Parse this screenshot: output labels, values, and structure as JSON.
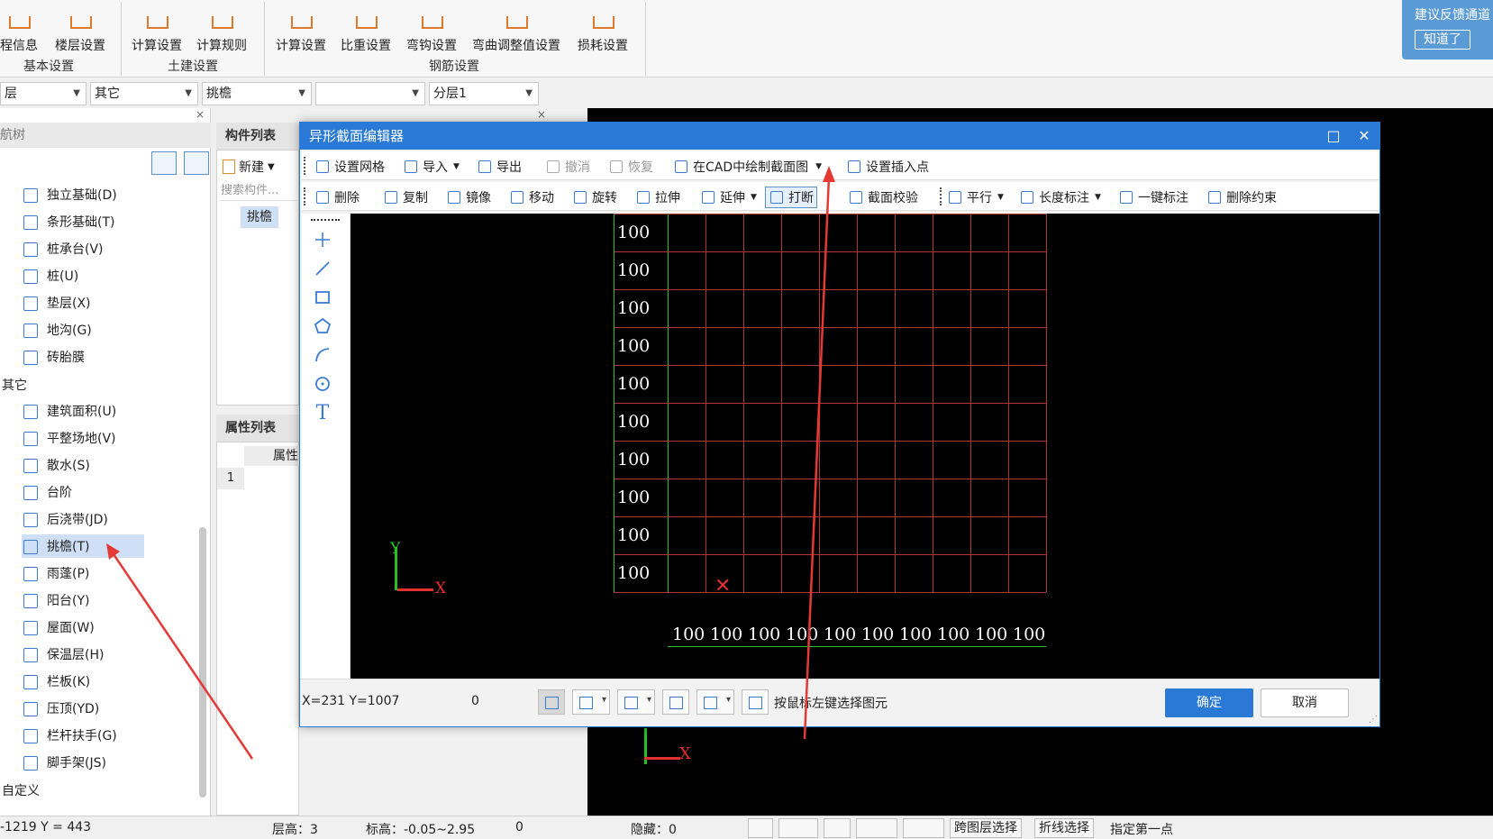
{
  "ribbon": {
    "buttons": [
      "程信息",
      "楼层设置",
      "计算设置",
      "计算规则",
      "计算设置",
      "比重设置",
      "弯钩设置",
      "弯曲调整值设置",
      "损耗设置"
    ],
    "groups": [
      "基本设置",
      "土建设置",
      "钢筋设置"
    ]
  },
  "feedback": {
    "text": "建议反馈通道",
    "button": "知道了"
  },
  "dropdowns": [
    "层",
    "其它",
    "挑檐",
    "",
    "分层1"
  ],
  "left_panel": {
    "header": "航树",
    "items": [
      {
        "label": "独立基础(D)",
        "icon": "isolated-footing-icon"
      },
      {
        "label": "条形基础(T)",
        "icon": "strip-footing-icon"
      },
      {
        "label": "桩承台(V)",
        "icon": "pile-cap-icon"
      },
      {
        "label": "桩(U)",
        "icon": "pile-icon"
      },
      {
        "label": "垫层(X)",
        "icon": "cushion-icon"
      },
      {
        "label": "地沟(G)",
        "icon": "trench-icon"
      },
      {
        "label": "砖胎膜",
        "icon": "brick-mold-icon"
      }
    ],
    "category_other": "其它",
    "other_items": [
      {
        "label": "建筑面积(U)",
        "icon": "building-area-icon"
      },
      {
        "label": "平整场地(V)",
        "icon": "site-leveling-icon"
      },
      {
        "label": "散水(S)",
        "icon": "apron-icon"
      },
      {
        "label": "台阶",
        "icon": "steps-icon"
      },
      {
        "label": "后浇带(JD)",
        "icon": "post-pour-strip-icon"
      },
      {
        "label": "挑檐(T)",
        "icon": "cornice-icon"
      },
      {
        "label": "雨蓬(P)",
        "icon": "canopy-icon"
      },
      {
        "label": "阳台(Y)",
        "icon": "balcony-icon"
      },
      {
        "label": "屋面(W)",
        "icon": "roof-icon"
      },
      {
        "label": "保温层(H)",
        "icon": "insulation-icon"
      },
      {
        "label": "栏板(K)",
        "icon": "parapet-icon"
      },
      {
        "label": "压顶(YD)",
        "icon": "coping-icon"
      },
      {
        "label": "栏杆扶手(G)",
        "icon": "railing-icon"
      },
      {
        "label": "脚手架(JS)",
        "icon": "scaffold-icon"
      }
    ],
    "category_custom": "自定义"
  },
  "mid_panel": {
    "component_list_title": "构件列表",
    "new_button": "新建",
    "search_placeholder": "搜索构件...",
    "selected_component": "挑檐",
    "property_list_title": "属性列表",
    "property_col": "属性",
    "row_index": "1"
  },
  "dialog": {
    "title": "异形截面编辑器",
    "toolbar1": {
      "grid": "设置网格",
      "import": "导入",
      "export": "导出",
      "undo": "撤消",
      "redo": "恢复",
      "cad_draw": "在CAD中绘制截面图",
      "insert_point": "设置插入点"
    },
    "toolbar2": {
      "delete": "删除",
      "copy": "复制",
      "mirror": "镜像",
      "move": "移动",
      "rotate": "旋转",
      "stretch": "拉伸",
      "extend": "延伸",
      "break": "打断",
      "check": "截面校验",
      "parallel": "平行",
      "length_dim": "长度标注",
      "one_click_dim": "一键标注",
      "remove_constraint": "删除约束"
    },
    "side_tools": [
      "point-tool-icon",
      "line-tool-icon",
      "rectangle-tool-icon",
      "polygon-tool-icon",
      "arc-tool-icon",
      "circle-tool-icon",
      "text-tool-icon"
    ],
    "text_tool_glyph": "T",
    "grid_y_labels": [
      "100",
      "100",
      "100",
      "100",
      "100",
      "100",
      "100",
      "100",
      "100",
      "100"
    ],
    "grid_x_labels": [
      "100",
      "100",
      "100",
      "100",
      "100",
      "100",
      "100",
      "100",
      "100",
      "100"
    ],
    "axis_y": "Y",
    "axis_x": "X",
    "footer": {
      "coords": "X=231 Y=1007",
      "value": "0",
      "hint": "按鼠标左键选择图元",
      "ok": "确定",
      "cancel": "取消"
    }
  },
  "cad_axis_x": "X",
  "status_bar": {
    "coords": "-1219 Y = 443",
    "floor_height": "层高：3",
    "elevation": "标高：-0.05~2.95",
    "zero": "0",
    "hidden": "隐藏：0",
    "btn_cross_layer": "跨图层选择",
    "btn_polyline": "折线选择",
    "hint": "指定第一点"
  },
  "colors": {
    "accent": "#2b79d6",
    "grid": "#b03636",
    "axis_green": "#22c322",
    "axis_red": "#e03030",
    "annotation_arrow": "#e53935"
  }
}
